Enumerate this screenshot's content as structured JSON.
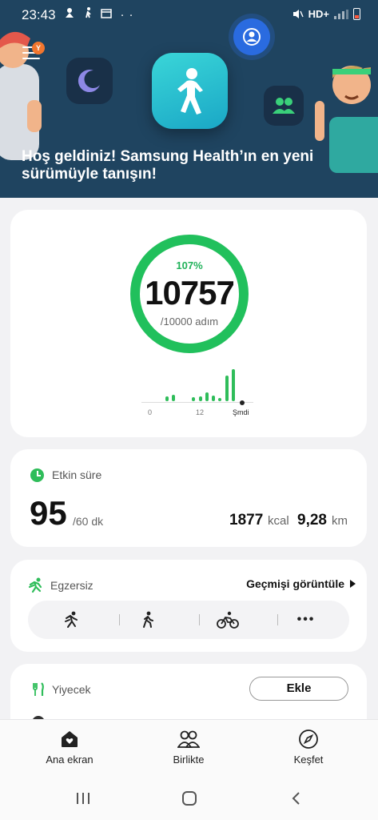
{
  "status_bar": {
    "time": "23:43",
    "left_icons": [
      "weather-icon",
      "person-walk-icon",
      "walk-icon",
      "calendar-icon",
      "more-dots-icon"
    ],
    "right_text": "HD+",
    "battery_color": "#ff5a3c"
  },
  "hero": {
    "message": "Hoş geldiniz! Samsung Health’ın en yeni sürümüyle tanışın!",
    "menu_badge": "Y",
    "background": "#1f4460"
  },
  "steps": {
    "percent": "107%",
    "value": "10757",
    "goal": "/10000 adım",
    "progress_fraction": 1.0757,
    "accent": "#21b25a",
    "axis_start": "0",
    "axis_mid": "12",
    "axis_now": "Şmdi",
    "hourly_bars": [
      6,
      8,
      0,
      0,
      5,
      6,
      10,
      7,
      4,
      30,
      38
    ]
  },
  "active_time": {
    "title": "Etkin süre",
    "value": "95",
    "goal": "/60 dk",
    "kcal": "1877",
    "kcal_unit": "kcal",
    "distance": "9,28",
    "distance_unit": "km"
  },
  "exercise": {
    "title": "Egzersiz",
    "history_link": "Geçmişi görüntüle",
    "buttons": [
      "running-icon",
      "walking-icon",
      "cycling-icon",
      "more-icon"
    ],
    "more_label": "•••"
  },
  "food": {
    "title": "Yiyecek",
    "add_label": "Ekle"
  },
  "bottom_nav": {
    "home": "Ana ekran",
    "together": "Birlikte",
    "discover": "Keşfet"
  }
}
